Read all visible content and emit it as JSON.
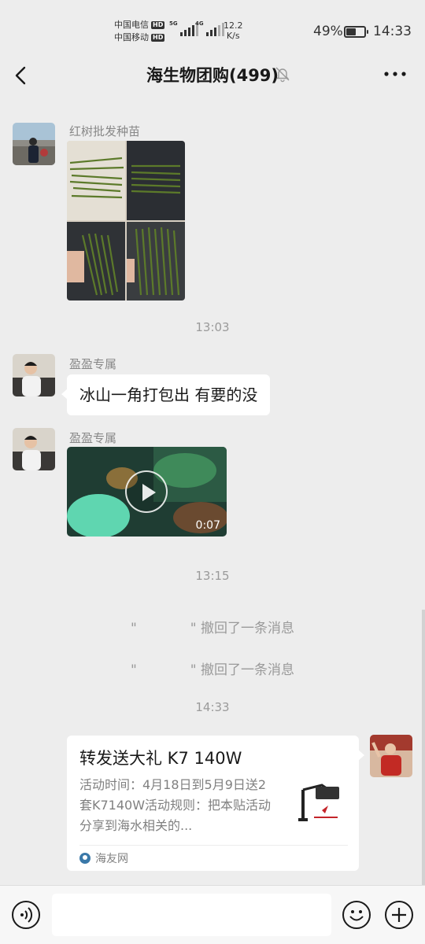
{
  "status_bar": {
    "carrier1": "中国电信",
    "carrier2": "中国移动",
    "hd": "HD",
    "signal1_type": "5G",
    "signal2_type": "4G",
    "speed_value": "12.2",
    "speed_unit": "K/s",
    "battery_text": "49%",
    "battery_level": 0.49,
    "time": "14:33"
  },
  "header": {
    "title": "海生物团购(499)",
    "icons": [
      "chevron-left-icon",
      "bell-muted-icon",
      "more-icon"
    ]
  },
  "messages": [
    {
      "sender": "红树批发种苗",
      "type": "image"
    },
    {
      "timestamp": "13:03"
    },
    {
      "sender": "盈盈专属",
      "type": "text",
      "text": "冰山一角打包出 有要的没"
    },
    {
      "sender": "盈盈专属",
      "type": "video",
      "duration": "0:07"
    },
    {
      "timestamp": "13:15"
    },
    {
      "recall_quote": "\"",
      "recall_text": "\" 撤回了一条消息"
    },
    {
      "recall_quote": "\"",
      "recall_text": "\" 撤回了一条消息"
    },
    {
      "timestamp": "14:33"
    },
    {
      "type": "link_card",
      "title": "转发送大礼 K7 140W",
      "description": "活动时间：4月18日到5月9日送2套K7140W活动规则：把本贴活动分享到海水相关的...",
      "source": "海友网"
    }
  ],
  "colors": {
    "background": "#ededed",
    "bubble": "#ffffff",
    "muted_text": "#9a9a9a"
  }
}
